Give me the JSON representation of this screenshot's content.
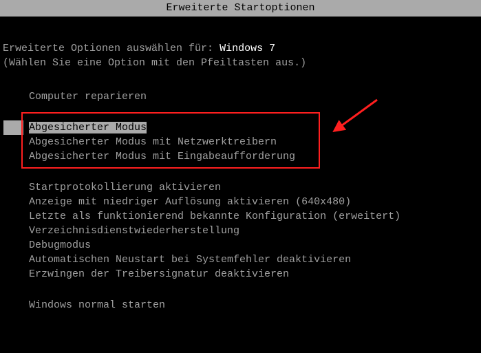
{
  "title": "Erweiterte Startoptionen",
  "prompt_prefix": "Erweiterte Optionen auswählen für: ",
  "os_name": "Windows 7",
  "hint": "(Wählen Sie eine Option mit den Pfeiltasten aus.)",
  "group1": [
    "Computer reparieren"
  ],
  "group2": [
    "Abgesicherter Modus",
    "Abgesicherter Modus mit Netzwerktreibern",
    "Abgesicherter Modus mit Eingabeaufforderung"
  ],
  "group3": [
    "Startprotokollierung aktivieren",
    "Anzeige mit niedriger Auflösung aktivieren (640x480)",
    "Letzte als funktionierend bekannte Konfiguration (erweitert)",
    "Verzeichnisdienstwiederherstellung",
    "Debugmodus",
    "Automatischen Neustart bei Systemfehler deaktivieren",
    "Erzwingen der Treibersignatur deaktivieren"
  ],
  "group4": [
    "Windows normal starten"
  ],
  "selected_index_group2": 0
}
